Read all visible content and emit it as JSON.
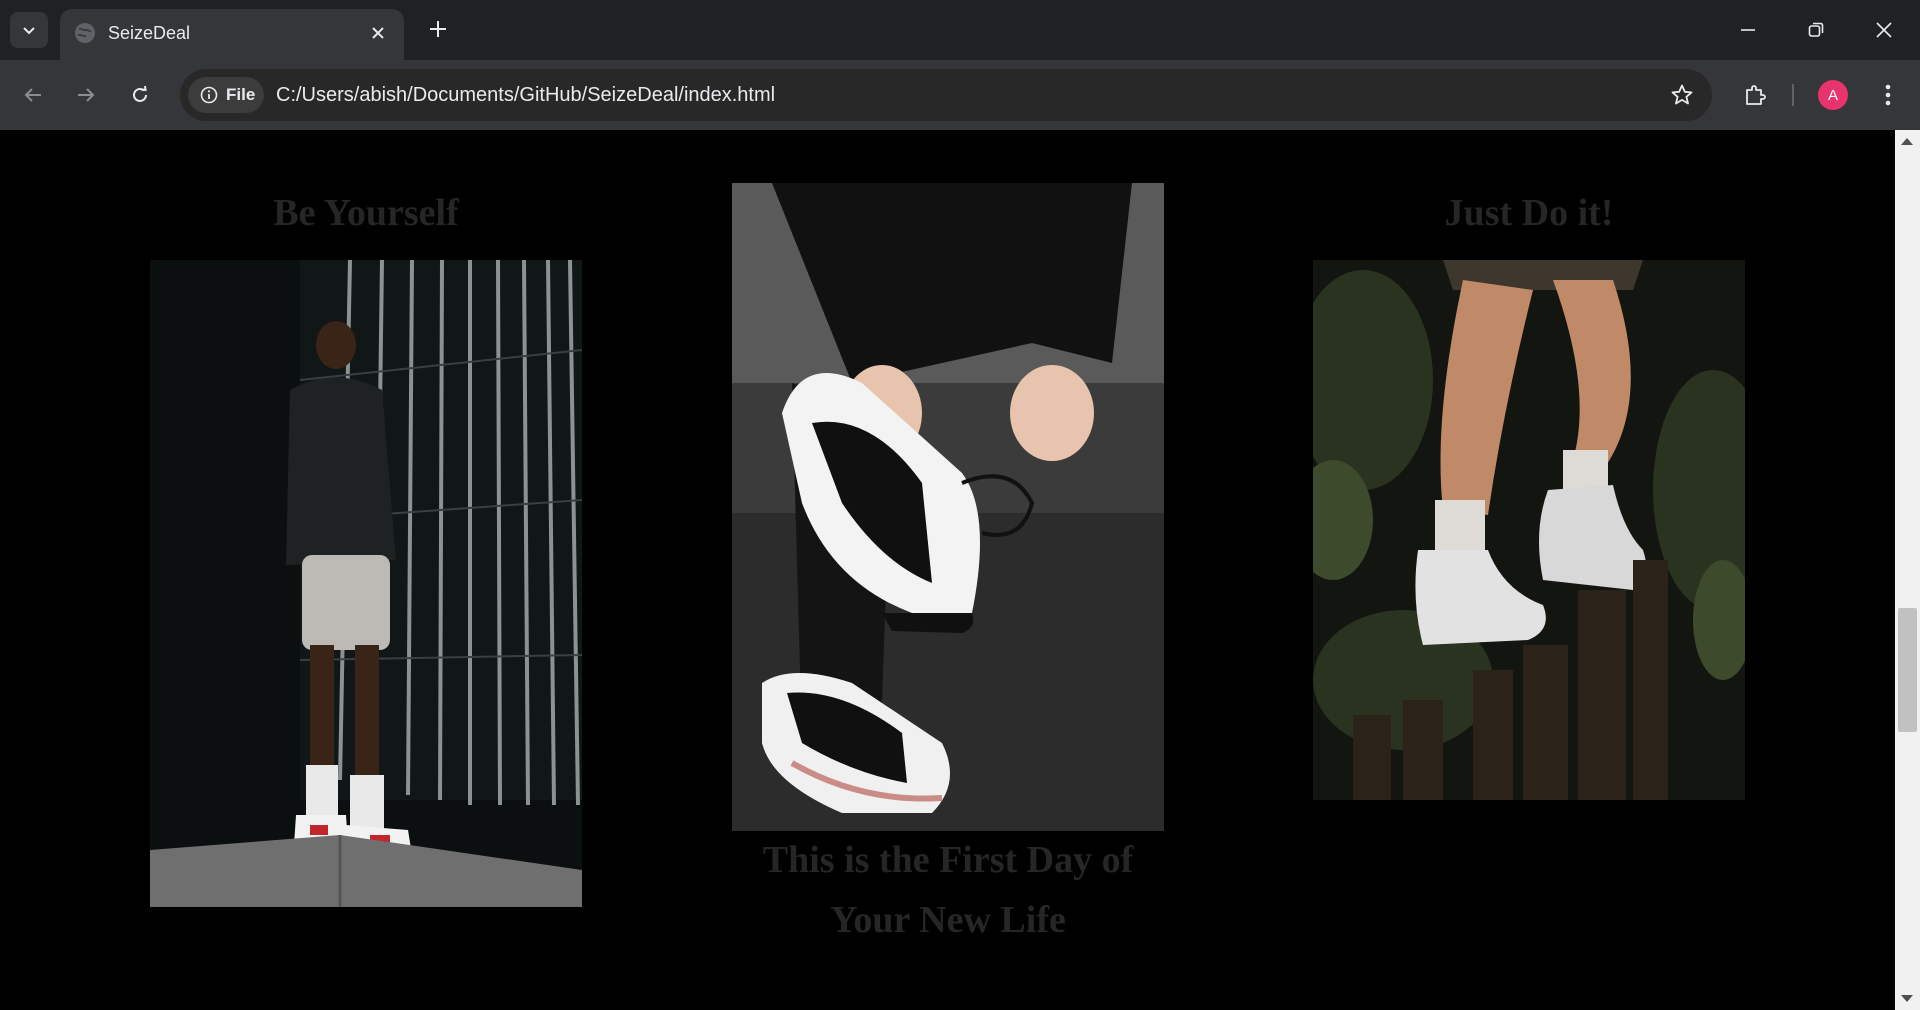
{
  "browser": {
    "tab_title": "SeizeDeal",
    "address_chip": "File",
    "url": "C:/Users/abish/Documents/GitHub/SeizeDeal/index.html",
    "profile_initial": "A",
    "profile_color": "#e8336d"
  },
  "page": {
    "background": "#000000",
    "heading_color": "#262626",
    "cards": [
      {
        "heading": "Be Yourself",
        "image": "man-standing-in-sneakers-photo"
      },
      {
        "heading": "This is the First Day of Your New Life",
        "image": "hands-holding-black-white-sneaker-photo"
      },
      {
        "heading": "Just Do it!",
        "image": "legs-white-high-top-sneakers-photo"
      }
    ]
  }
}
